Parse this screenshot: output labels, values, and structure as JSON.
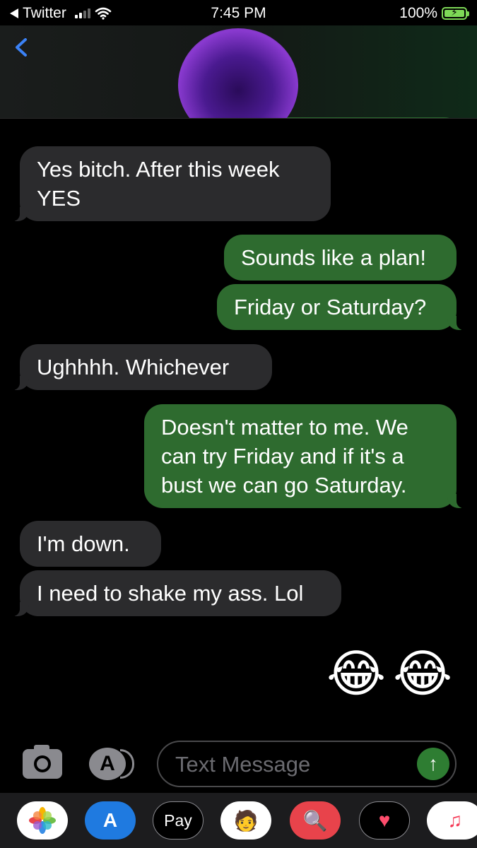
{
  "status_bar": {
    "back_app": "Twitter",
    "time": "7:45 PM",
    "battery": "100%"
  },
  "header": {
    "contact_name_obscured": true
  },
  "messages": [
    {
      "side": "in",
      "lines": [
        "Yes bitch. After this week",
        "YES"
      ]
    },
    {
      "side": "out",
      "lines": [
        "Sounds like a plan!"
      ]
    },
    {
      "side": "out",
      "lines": [
        "Friday or Saturday?"
      ]
    },
    {
      "side": "in",
      "lines": [
        "Ughhhh. Whichever"
      ]
    },
    {
      "side": "out",
      "lines": [
        "Doesn't matter to me. We",
        "can try Friday and if it's a",
        "bust we can go Saturday."
      ]
    },
    {
      "side": "in",
      "lines": [
        "I'm down."
      ]
    },
    {
      "side": "in",
      "lines": [
        "I need to shake my ass. Lol"
      ]
    },
    {
      "side": "out",
      "emoji": [
        "😂",
        "😂"
      ]
    }
  ],
  "composer": {
    "placeholder": "Text Message",
    "send_icon": "arrow-up-icon"
  },
  "app_drawer": {
    "apps": [
      "photos-icon",
      "app-store-icon",
      "apple-pay-icon",
      "memoji-icon",
      "web-search-icon",
      "digital-touch-icon",
      "music-icon"
    ],
    "apple_pay_label": "Pay"
  },
  "colors": {
    "incoming_bubble": "#2b2b2d",
    "outgoing_bubble": "#2e6b2f",
    "back_chevron": "#3b82f6",
    "battery": "#7ed957"
  }
}
